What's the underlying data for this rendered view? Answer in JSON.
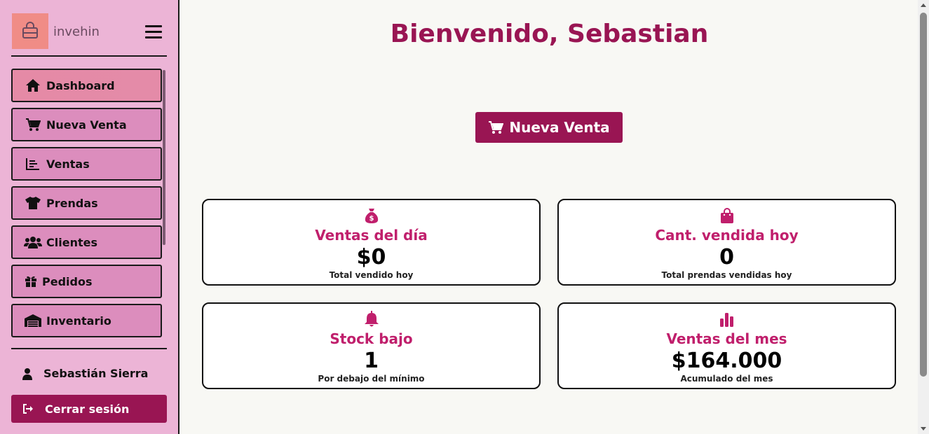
{
  "sidebar": {
    "brand": "invehin",
    "nav": [
      {
        "label": "Dashboard",
        "icon": "home-icon"
      },
      {
        "label": "Nueva Venta",
        "icon": "cart-icon"
      },
      {
        "label": "Ventas",
        "icon": "chart-icon"
      },
      {
        "label": "Prendas",
        "icon": "shirt-icon"
      },
      {
        "label": "Clientes",
        "icon": "users-icon"
      },
      {
        "label": "Pedidos",
        "icon": "gift-icon"
      },
      {
        "label": "Inventario",
        "icon": "warehouse-icon"
      }
    ],
    "user_name": "Sebastián Sierra",
    "logout_label": "Cerrar sesión"
  },
  "main": {
    "title": "Bienvenido, Sebastian",
    "new_sale_label": "Nueva Venta",
    "cards": [
      {
        "label": "Ventas del día",
        "value": "$0",
        "sub": "Total vendido hoy",
        "icon": "money-bag-icon"
      },
      {
        "label": "Cant. vendida hoy",
        "value": "0",
        "sub": "Total prendas vendidas hoy",
        "icon": "shopping-bag-icon"
      },
      {
        "label": "Stock bajo",
        "value": "1",
        "sub": "Por debajo del mínimo",
        "icon": "bell-icon"
      },
      {
        "label": "Ventas del mes",
        "value": "$164.000",
        "sub": "Acumulado del mes",
        "icon": "bar-chart-icon"
      }
    ]
  },
  "colors": {
    "accent": "#991553",
    "card_label": "#c01f6c",
    "sidebar_bg": "#ecb4d6",
    "nav_item_bg": "#dc8dbd",
    "nav_active_bg": "#e58aa6",
    "logo_bg": "#f08c86"
  }
}
